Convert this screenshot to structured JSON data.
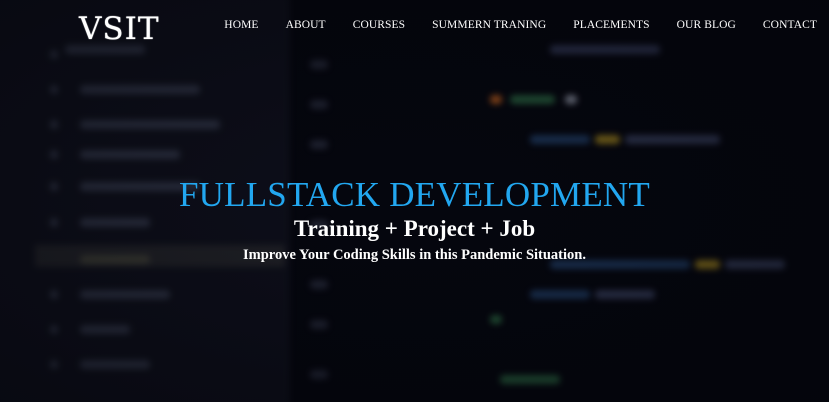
{
  "brand": {
    "logo": "VSIT"
  },
  "nav": {
    "items": [
      "HOME",
      "ABOUT",
      "COURSES",
      "SUMMERN TRANING",
      "PLACEMENTS",
      "OUR BLOG",
      "CONTACT"
    ]
  },
  "hero": {
    "title": "FULLSTACK DEVELOPMENT",
    "subtitle": "Training + Project + Job",
    "tagline": "Improve Your Coding Skills in this Pandemic Situation.",
    "colors": {
      "title": "#22a7f0",
      "text": "#ffffff",
      "background": "#05060d"
    }
  }
}
